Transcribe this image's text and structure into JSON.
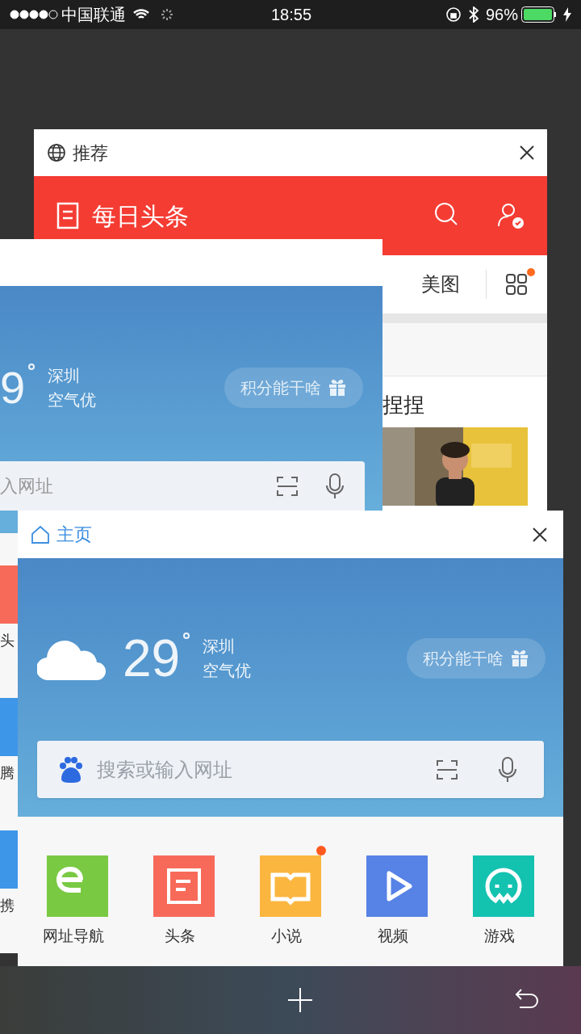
{
  "status_bar": {
    "carrier": "中国联通",
    "time": "18:55",
    "battery": "96%"
  },
  "back_card": {
    "title": "推荐",
    "app_title": "每日头条",
    "channel_tabs": [
      "美图"
    ],
    "menu_has_update": true,
    "headline": "捏捏"
  },
  "middle_card": {
    "temperature": "9",
    "city": "深圳",
    "air": "空气优",
    "points_button": "积分能干啥",
    "search_placeholder": "入网址",
    "apps": [
      {
        "label": "头",
        "color": "#f76a5a"
      },
      {
        "label": "腾",
        "color": "#3e96e8"
      },
      {
        "label": "携",
        "color": "#3e96e8"
      }
    ]
  },
  "front_card": {
    "title": "主页",
    "temperature": "29",
    "city": "深圳",
    "air": "空气优",
    "points_button": "积分能干啥",
    "search_placeholder": "搜索或输入网址",
    "apps": [
      {
        "label": "网址导航",
        "kind": "nav",
        "color": "#7ac943",
        "badge": false
      },
      {
        "label": "头条",
        "kind": "news",
        "color": "#f76a5a",
        "badge": false
      },
      {
        "label": "小说",
        "kind": "novel",
        "color": "#fbb63f",
        "badge": true
      },
      {
        "label": "视频",
        "kind": "video",
        "color": "#5782e6",
        "badge": false
      },
      {
        "label": "游戏",
        "kind": "game",
        "color": "#14c2b0",
        "badge": false
      }
    ]
  }
}
